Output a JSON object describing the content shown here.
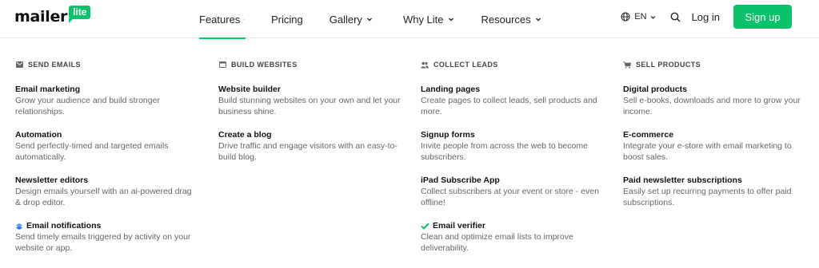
{
  "brand": {
    "name": "mailer",
    "badge": "lite",
    "color": "#09c269"
  },
  "nav": [
    {
      "label": "Features",
      "chevron": "up",
      "active": true
    },
    {
      "label": "Pricing"
    },
    {
      "label": "Gallery",
      "chevron": "down"
    },
    {
      "label": "Why Lite",
      "chevron": "down"
    },
    {
      "label": "Resources",
      "chevron": "down"
    }
  ],
  "header_right": {
    "language": "EN",
    "login": "Log in",
    "signup": "Sign up"
  },
  "columns": [
    {
      "heading": "SEND EMAILS",
      "icon": "envelope-icon",
      "items": [
        {
          "title": "Email marketing",
          "desc": "Grow your audience and build stronger relationships."
        },
        {
          "title": "Automation",
          "desc": "Send perfectly-timed and targeted emails automatically."
        },
        {
          "title": "Newsletter editors",
          "desc": "Design emails yourself with an ai-powered drag & drop editor."
        },
        {
          "title": "Email notifications",
          "desc": "Send timely emails triggered by activity on your website or app.",
          "icon": "layers-icon"
        }
      ]
    },
    {
      "heading": "BUILD WEBSITES",
      "icon": "browser-icon",
      "items": [
        {
          "title": "Website builder",
          "desc": "Build stunning websites on your own and let your business shine."
        },
        {
          "title": "Create a blog",
          "desc": "Drive traffic and engage visitors with an easy-to-build blog."
        }
      ]
    },
    {
      "heading": "COLLECT LEADS",
      "icon": "users-icon",
      "items": [
        {
          "title": "Landing pages",
          "desc": "Create pages to collect leads, sell products and more."
        },
        {
          "title": "Signup forms",
          "desc": "Invite people from across the web to become subscribers."
        },
        {
          "title": "iPad Subscribe App",
          "desc": "Collect subscribers at your event or store - even offline!"
        },
        {
          "title": "Email verifier",
          "desc": "Clean and optimize email lists to improve deliverability.",
          "icon": "checkmark-icon"
        }
      ]
    },
    {
      "heading": "SELL PRODUCTS",
      "icon": "cart-icon",
      "items": [
        {
          "title": "Digital products",
          "desc": "Sell e-books, downloads and more to grow your income."
        },
        {
          "title": "E-commerce",
          "desc": "Integrate your e-store with email marketing to boost sales."
        },
        {
          "title": "Paid newsletter subscriptions",
          "desc": "Easily set up recurring payments to offer paid subscriptions."
        }
      ]
    }
  ]
}
